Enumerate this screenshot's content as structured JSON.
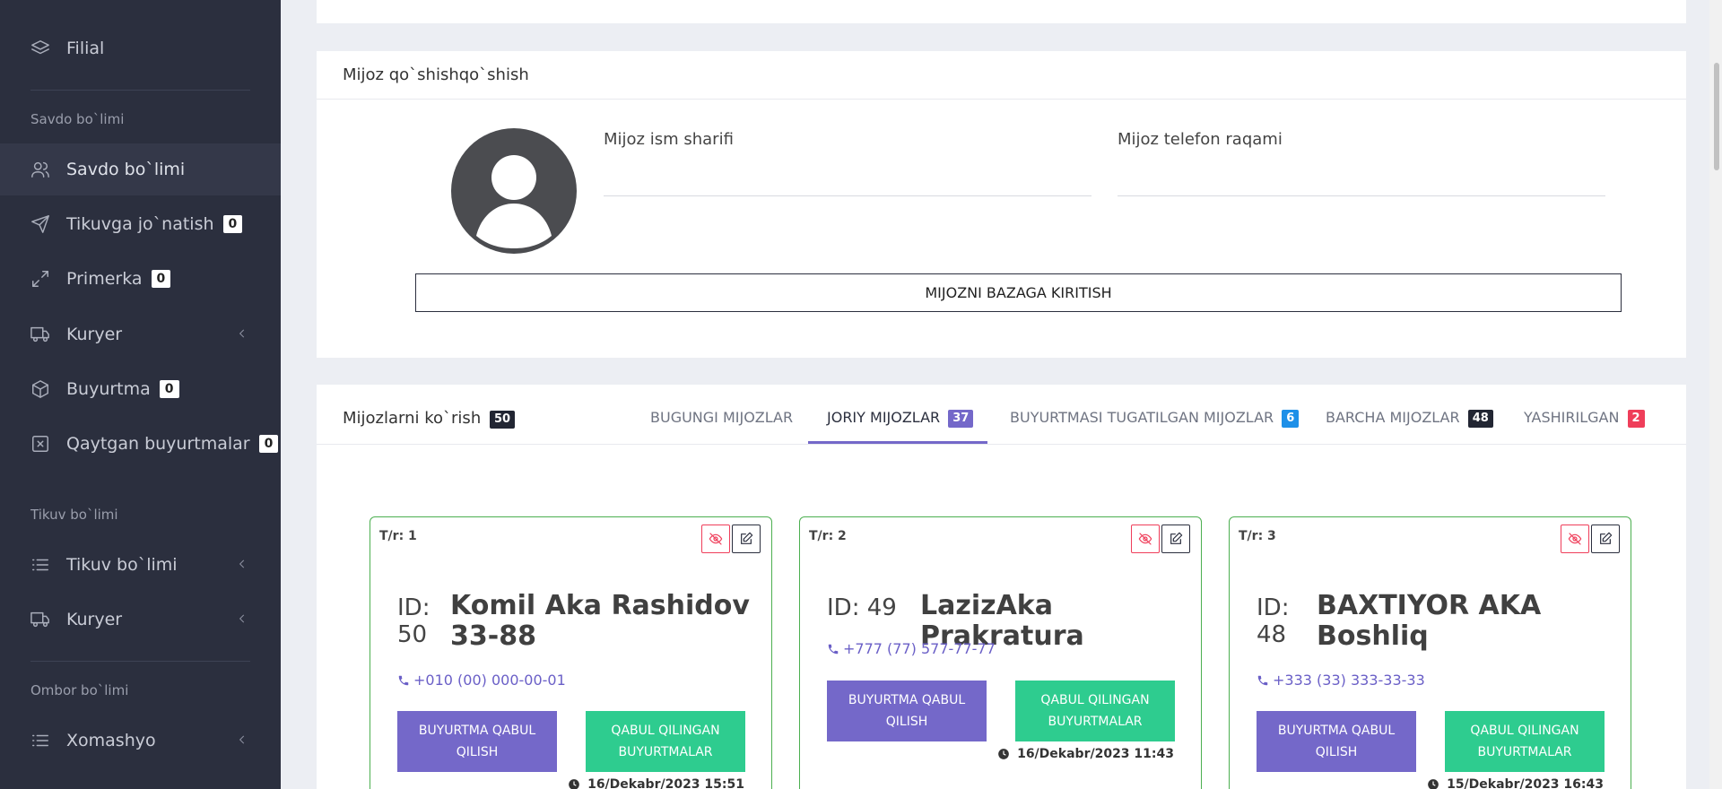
{
  "sidebar": {
    "top_item": {
      "label": "Filial",
      "icon": "layers-icon"
    },
    "sections": [
      {
        "heading": "Savdo bo`limi"
      },
      {
        "heading": "Tikuv bo`limi"
      },
      {
        "heading": "Ombor bo`limi"
      }
    ],
    "items": [
      {
        "label": "Savdo bo`limi",
        "icon": "users-icon",
        "active": true
      },
      {
        "label": "Tikuvga jo`natish",
        "badge": "0",
        "icon": "send-icon"
      },
      {
        "label": "Primerka",
        "badge": "0",
        "icon": "expand-icon"
      },
      {
        "label": "Kuryer",
        "icon": "truck-icon",
        "chevron": true
      },
      {
        "label": "Buyurtma",
        "badge": "0",
        "icon": "box-icon"
      },
      {
        "label": "Qaytgan buyurtmalar",
        "badge": "0",
        "icon": "x-square-icon"
      },
      {
        "label": "Tikuv bo`limi",
        "icon": "list-icon",
        "chevron": true
      },
      {
        "label": "Kuryer",
        "icon": "truck-icon",
        "chevron": true
      },
      {
        "label": "Xomashyo",
        "icon": "list-icon",
        "chevron": true
      }
    ]
  },
  "add_client": {
    "title": "Mijoz qo`shishqo`shish",
    "name_label": "Mijoz ism sharifi",
    "name_value": "",
    "phone_label": "Mijoz telefon raqami",
    "phone_value": "",
    "submit_label": "MIJOZNI BAZAGA KIRITISH"
  },
  "client_list": {
    "title": "Mijozlarni ko`rish",
    "count": "50",
    "tabs": [
      {
        "label": "BUGUNGI MIJOZLAR"
      },
      {
        "label": "JORIY MIJOZLAR",
        "badge": "37",
        "active": true
      },
      {
        "label": "BUYURTMASI TUGATILGAN MIJOZLAR",
        "badge": "6"
      },
      {
        "label": "BARCHA MIJOZLAR",
        "badge": "48"
      },
      {
        "label": "YASHIRILGAN",
        "badge": "2"
      }
    ],
    "cards": [
      {
        "tr": "T/r: 1",
        "id_label": "ID:",
        "id": "50",
        "name": "Komil Aka Rashidov 33-88",
        "phone": "+010 (00) 000-00-01",
        "btn_accept": "BUYURTMA QABUL QILISH",
        "btn_received": "QABUL QILINGAN BUYURTMALAR",
        "date": "16/Dekabr/2023 15:51"
      },
      {
        "tr": "T/r: 2",
        "id_label": "ID:",
        "id": "49",
        "name": "LazizAka Prakratura",
        "phone": "+777 (77) 577-77-77",
        "btn_accept": "BUYURTMA QABUL QILISH",
        "btn_received": "QABUL QILINGAN BUYURTMALAR",
        "date": "16/Dekabr/2023 11:43"
      },
      {
        "tr": "T/r: 3",
        "id_label": "ID:",
        "id": "48",
        "name": "BAXTIYOR AKA Boshliq",
        "phone": "+333 (33) 333-33-33",
        "btn_accept": "BUYURTMA QABUL QILISH",
        "btn_received": "QABUL QILINGAN BUYURTMALAR",
        "date": "15/Dekabr/2023 16:43"
      }
    ]
  },
  "colors": {
    "sidebar_bg": "#2b2f3e",
    "accent_purple": "#7468c9",
    "accent_green": "#2ecc8f",
    "danger": "#ef3e5a",
    "info": "#1e90e8",
    "card_border": "#4caf50"
  }
}
